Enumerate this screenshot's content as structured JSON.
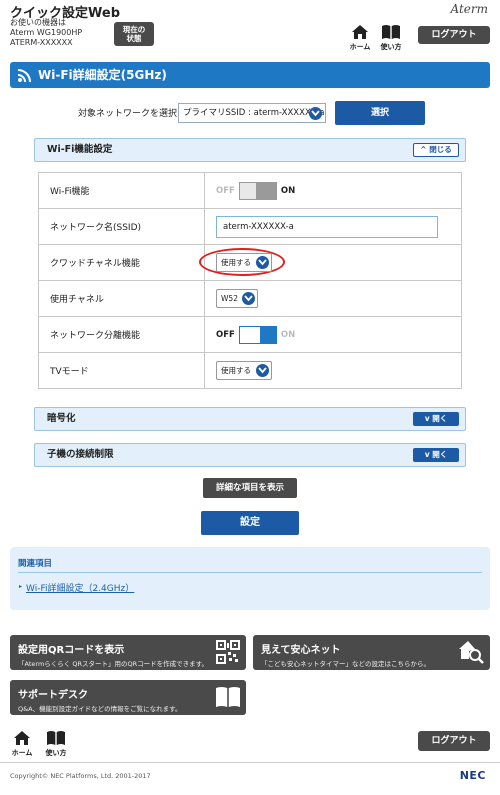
{
  "header": {
    "app_title": "クイック設定Web",
    "device_label": "お使いの機器は",
    "device_model": "Aterm WG1900HP",
    "device_name": "ATERM-XXXXXX",
    "status_button": [
      "現在の",
      "状態"
    ],
    "brand": "Aterm",
    "home_label": "ホーム",
    "help_label": "使い方",
    "logout_label": "ログアウト"
  },
  "page": {
    "title": "Wi-Fi詳細設定(5GHz)"
  },
  "network_select": {
    "label": "対象ネットワークを選択",
    "value": "プライマリSSID : aterm-XXXXXX-a",
    "button_label": "選択"
  },
  "wifi_panel": {
    "title": "Wi-Fi機能設定",
    "toggle_label": "閉じる",
    "rows": [
      {
        "key": "Wi-Fi機能",
        "off": "OFF",
        "on": "ON",
        "state": "on"
      },
      {
        "key": "ネットワーク名(SSID)",
        "value": "aterm-XXXXXX-a"
      },
      {
        "key": "クワッドチャネル機能",
        "value": "使用する"
      },
      {
        "key": "使用チャネル",
        "value": "W52"
      },
      {
        "key": "ネットワーク分離機能",
        "off": "OFF",
        "on": "ON",
        "state": "off"
      },
      {
        "key": "TVモード",
        "value": "使用する"
      }
    ]
  },
  "encryption_panel": {
    "title": "暗号化",
    "toggle_label": "開く"
  },
  "child_panel": {
    "title": "子機の接続制限",
    "toggle_label": "開く"
  },
  "buttons": {
    "show_details": "詳細な項目を表示",
    "apply": "設定"
  },
  "related": {
    "title": "関連項目",
    "link": "Wi-Fi詳細設定（2.4GHz）"
  },
  "tiles": {
    "qr": {
      "title": "設定用QRコードを表示",
      "sub": "「Atermらくらく QRスタート」用のQRコードを作成できます。"
    },
    "safety": {
      "title": "見えて安心ネット",
      "sub": "「こども安心ネットタイマー」などの設定はこちらから。"
    },
    "support": {
      "title": "サポートデスク",
      "sub": "Q&A、機能別設定ガイドなどの情報をご覧になれます。"
    }
  },
  "footer": {
    "home_label": "ホーム",
    "help_label": "使い方",
    "logout_label": "ログアウト",
    "copyright": "Copyright© NEC Platforms, Ltd. 2001-2017",
    "brand": "NEC"
  },
  "colors": {
    "primary": "#1f78c4",
    "dark_button": "#4a4a4a",
    "highlight_ring": "#e31d1d"
  }
}
